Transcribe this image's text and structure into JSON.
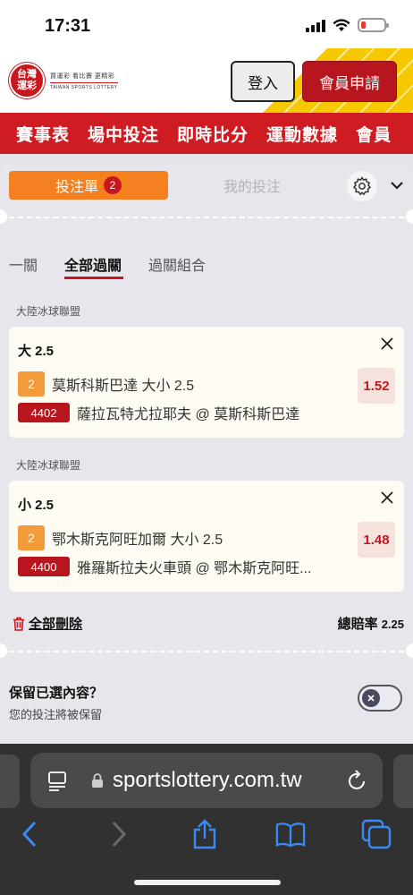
{
  "status": {
    "time": "17:31"
  },
  "header": {
    "logo_line1": "台灣",
    "logo_line2": "運彩",
    "logo_tagline": "買運彩 看比賽 更精彩",
    "logo_english": "TAIWAN SPORTS LOTTERY",
    "login_label": "登入",
    "register_label": "會員申請"
  },
  "nav": {
    "items": [
      "賽事表",
      "場中投注",
      "即時比分",
      "運動數據",
      "會員"
    ]
  },
  "betslip": {
    "tab_betslip": "投注單",
    "bet_count": "2",
    "tab_mybets": "我的投注",
    "mode_tabs": [
      "一關",
      "全部過關",
      "過關組合"
    ],
    "active_mode": "全部過關",
    "selections": [
      {
        "league": "大陸冰球聯盟",
        "title": "大 2.5",
        "num": "2",
        "market": "莫斯科斯巴達 大小 2.5",
        "code": "4402",
        "match": "薩拉瓦特尤拉耶夫 @ 莫斯科斯巴達",
        "odds": "1.52"
      },
      {
        "league": "大陸冰球聯盟",
        "title": "小 2.5",
        "num": "2",
        "market": "鄂木斯克阿旺加爾 大小 2.5",
        "code": "4400",
        "match": "雅羅斯拉夫火車頭 @ 鄂木斯克阿旺...",
        "odds": "1.48"
      }
    ],
    "delete_all": "全部刪除",
    "total_odds_label": "總賠率",
    "total_odds_value": "2.25",
    "keep_title": "保留已選內容？",
    "keep_subtitle": "您的投注將被保留"
  },
  "browser": {
    "url": "sportslottery.com.tw"
  },
  "colors": {
    "brand_red": "#cf1b22",
    "orange": "#f5801f",
    "odds_red": "#c8161d"
  },
  "icons": [
    "gear-icon",
    "chevron-down-icon",
    "close-icon",
    "trash-icon",
    "reader-icon",
    "lock-icon",
    "reload-icon",
    "back-icon",
    "forward-icon",
    "share-icon",
    "bookmarks-icon",
    "tabs-icon"
  ]
}
